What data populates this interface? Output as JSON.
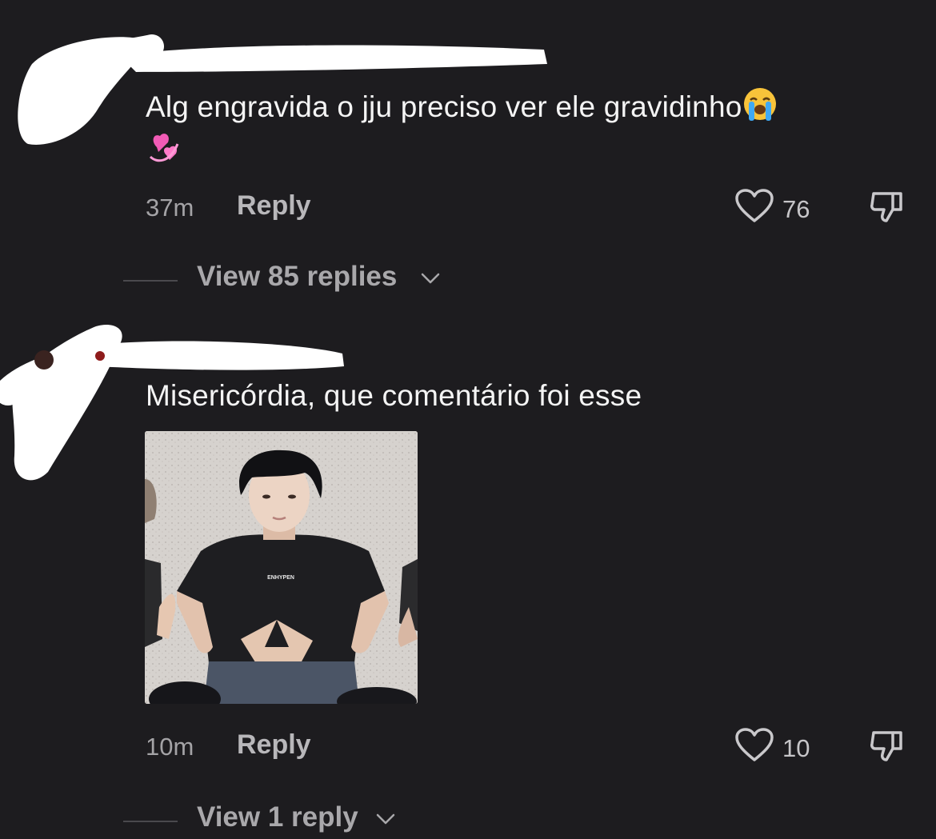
{
  "comments": [
    {
      "text": "Alg engravida o jju preciso ver ele gravidinho",
      "emojis": [
        "loudly-crying-face-icon",
        "revolving-hearts-icon"
      ],
      "time": "37m",
      "reply_label": "Reply",
      "likes": "76",
      "view_replies_label": "View 85 replies"
    },
    {
      "text": "Misericórdia, que comentário foi esse",
      "image": {
        "shirt_text": "ENHYPEN"
      },
      "time": "10m",
      "reply_label": "Reply",
      "likes": "10",
      "view_replies_label": "View 1 reply"
    }
  ],
  "colors": {
    "background": "#1d1c1f",
    "text": "#f4f4f4",
    "muted": "#a4a3a6",
    "redaction": "#ffffff"
  }
}
